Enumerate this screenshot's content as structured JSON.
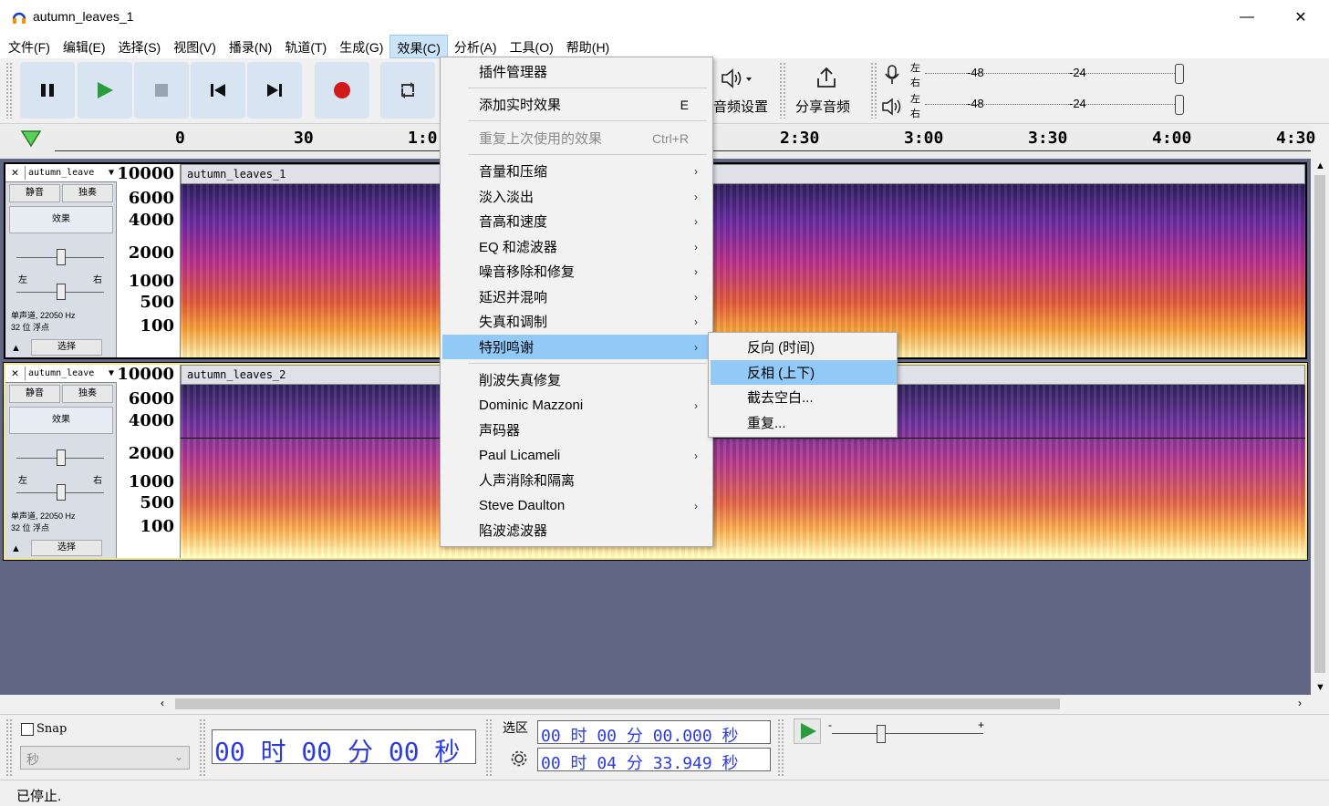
{
  "window": {
    "title": "autumn_leaves_1",
    "minimize": "—",
    "maximize": "☐",
    "close": "✕"
  },
  "menubar": [
    {
      "label": "文件(F)"
    },
    {
      "label": "编辑(E)"
    },
    {
      "label": "选择(S)"
    },
    {
      "label": "视图(V)"
    },
    {
      "label": "播录(N)"
    },
    {
      "label": "轨道(T)"
    },
    {
      "label": "生成(G)"
    },
    {
      "label": "效果(C)"
    },
    {
      "label": "分析(A)"
    },
    {
      "label": "工具(O)"
    },
    {
      "label": "帮助(H)"
    }
  ],
  "toolbar": {
    "audio_setup": "音频设置",
    "share_audio": "分享音频",
    "meter_left": "左",
    "meter_right": "右",
    "meter_ticks": [
      "-48",
      "-24"
    ]
  },
  "timeline": {
    "labels": [
      "0",
      "30",
      "1:0",
      "2:30",
      "3:00",
      "3:30",
      "4:00",
      "4:30"
    ]
  },
  "tracks": [
    {
      "name": "autumn_leave",
      "clip_name": "autumn_leaves_1",
      "mute": "静音",
      "solo": "独奏",
      "effects": "效果",
      "pan_left": "左",
      "pan_right": "右",
      "info_line1": "单声道, 22050 Hz",
      "info_line2": "32 位 浮点",
      "select": "选择",
      "y_labels": [
        "10000",
        "6000",
        "4000",
        "2000",
        "1000",
        "500",
        "100"
      ]
    },
    {
      "name": "autumn_leave",
      "clip_name": "autumn_leaves_2",
      "mute": "静音",
      "solo": "独奏",
      "effects": "效果",
      "pan_left": "左",
      "pan_right": "右",
      "info_line1": "单声道, 22050 Hz",
      "info_line2": "32 位 浮点",
      "select": "选择",
      "y_labels": [
        "10000",
        "6000",
        "4000",
        "2000",
        "1000",
        "500",
        "100"
      ]
    }
  ],
  "effects_menu": {
    "items": [
      {
        "label": "插件管理器"
      },
      {
        "label": "添加实时效果",
        "shortcut": "E"
      },
      {
        "label": "重复上次使用的效果",
        "shortcut": "Ctrl+R",
        "disabled": true
      },
      {
        "label": "音量和压缩",
        "submenu": true
      },
      {
        "label": "淡入淡出",
        "submenu": true
      },
      {
        "label": "音高和速度",
        "submenu": true
      },
      {
        "label": "EQ 和滤波器",
        "submenu": true
      },
      {
        "label": "噪音移除和修复",
        "submenu": true
      },
      {
        "label": "延迟并混响",
        "submenu": true
      },
      {
        "label": "失真和调制",
        "submenu": true
      },
      {
        "label": "特别鸣谢",
        "submenu": true,
        "highlighted": true
      },
      {
        "label": "削波失真修复"
      },
      {
        "label": "Dominic Mazzoni",
        "submenu": true
      },
      {
        "label": "声码器"
      },
      {
        "label": "Paul Licameli",
        "submenu": true
      },
      {
        "label": "人声消除和隔离"
      },
      {
        "label": "Steve Daulton",
        "submenu": true
      },
      {
        "label": "陷波滤波器"
      }
    ],
    "arrow": "›"
  },
  "special_thanks_submenu": {
    "items": [
      {
        "label": "反向 (时间)"
      },
      {
        "label": "反相 (上下)",
        "highlighted": true
      },
      {
        "label": "截去空白..."
      },
      {
        "label": "重复..."
      }
    ]
  },
  "bottom": {
    "snap_label": "Snap",
    "snap_unit": "秒",
    "time_display": "00 时 00 分 00 秒",
    "selection_label": "选区",
    "selection_start": "00 时 00 分 00.000 秒",
    "selection_end": "00 时 04 分 33.949 秒"
  },
  "status": {
    "text": "已停止."
  },
  "colors": {
    "menu_highlight": "#91c9f7",
    "transport_button": "#d9e4f2",
    "record_red": "#d11a1a",
    "play_green": "#2a9d3a",
    "track_area_bg": "#616685",
    "time_text_blue": "#2d3cd8"
  }
}
